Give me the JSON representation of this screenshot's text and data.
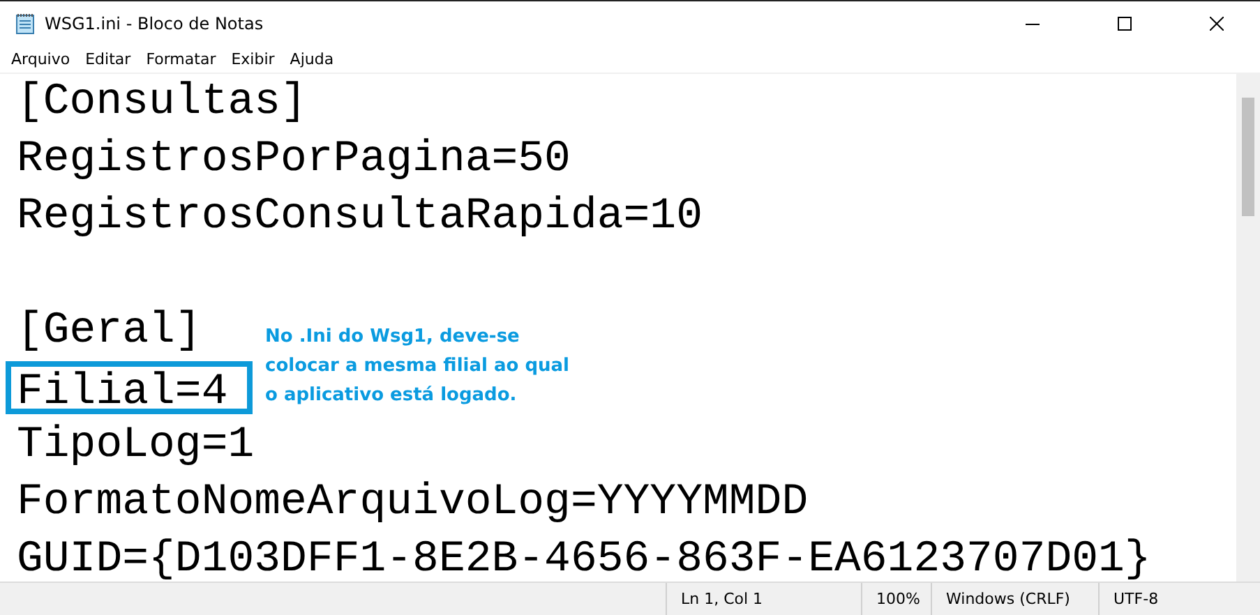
{
  "window": {
    "title": "WSG1.ini - Bloco de Notas"
  },
  "menu": [
    "Arquivo",
    "Editar",
    "Formatar",
    "Exibir",
    "Ajuda"
  ],
  "sections": [
    {
      "lines": [
        {
          "text": "[Consultas]",
          "highlighted": false
        },
        {
          "text": "RegistrosPorPagina=50",
          "highlighted": false
        },
        {
          "text": "RegistrosConsultaRapida=10",
          "highlighted": false
        }
      ]
    },
    {
      "lines": [
        {
          "text": "[Geral]",
          "highlighted": false
        },
        {
          "text": "Filial=4",
          "highlighted": true
        },
        {
          "text": "TipoLog=1",
          "highlighted": false
        },
        {
          "text": "FormatoNomeArquivoLog=YYYYMMDD",
          "highlighted": false
        },
        {
          "text": "GUID={D103DFF1-8E2B-4656-863F-EA6123707D01}",
          "highlighted": false
        }
      ]
    }
  ],
  "annotation": {
    "lines": [
      "No .Ini do Wsg1, deve-se",
      "colocar a mesma filial ao qual",
      "o aplicativo está logado."
    ]
  },
  "status_bar": {
    "position": "Ln 1, Col 1",
    "zoom": "100%",
    "line_ending": "Windows (CRLF)",
    "encoding": "UTF-8"
  }
}
